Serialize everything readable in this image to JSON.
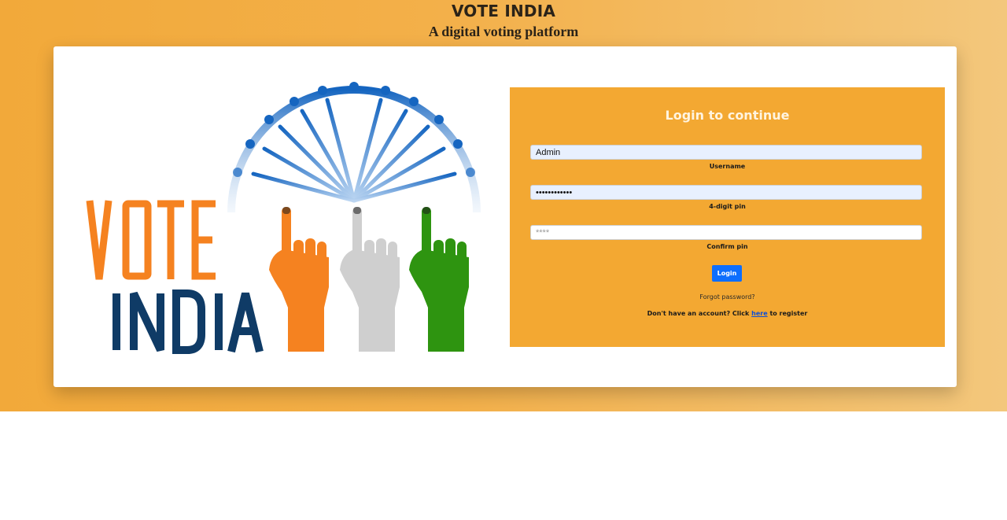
{
  "header": {
    "title": "VOTE INDIA",
    "subtitle": "A digital voting platform"
  },
  "hero": {
    "logo_word_1": "VOTE",
    "logo_word_2": "INDIA"
  },
  "login": {
    "heading": "Login to continue",
    "username": {
      "value": "Admin",
      "label": "Username"
    },
    "pin": {
      "value": "••••••••••••",
      "label": "4-digit pin"
    },
    "confirm_pin": {
      "placeholder": "****",
      "label": "Confirm pin"
    },
    "button_label": "Login",
    "forgot_text": "Forgot password?",
    "register_prefix": "Don't have an account? Click",
    "register_link": "here",
    "register_suffix": "to register"
  },
  "colors": {
    "banner": "#f3a832",
    "panel": "#f3a832",
    "button": "#0d6efd",
    "saffron": "#f58220",
    "green": "#2e9410",
    "chakra_blue": "#1565c0",
    "navy": "#0f3b66"
  },
  "icons": {
    "chakra": "ashoka-chakra-icon",
    "hands": "voting-finger-hands-icon"
  }
}
